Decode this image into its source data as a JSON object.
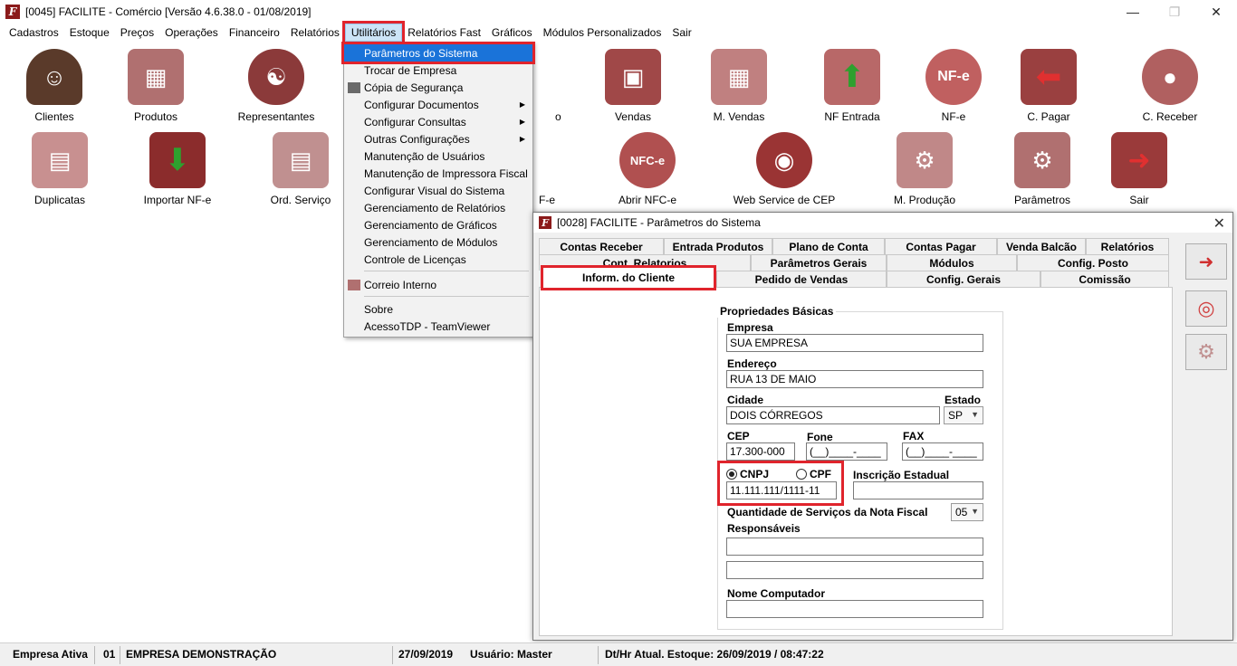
{
  "window": {
    "title": "[0045] FACILITE - Comércio [Versão 4.6.38.0 - 01/08/2019]",
    "min": "—",
    "max": "❐",
    "close": "✕"
  },
  "menu": [
    "Cadastros",
    "Estoque",
    "Preços",
    "Operações",
    "Financeiro",
    "Relatórios",
    "Utilitários",
    "Relatórios Fast",
    "Gráficos",
    "Módulos Personalizados",
    "Sair"
  ],
  "tiles": {
    "clientes": "Clientes",
    "produtos": "Produtos",
    "representantes": "Representantes",
    "o": "o",
    "vendas": "Vendas",
    "m_vendas": "M. Vendas",
    "nf_entrada": "NF Entrada",
    "nfe": "NF-e",
    "c_pagar": "C. Pagar",
    "c_receber": "C. Receber",
    "duplicatas": "Duplicatas",
    "importar_nfe": "Importar NF-e",
    "ord_servico": "Ord. Serviço",
    "f_e": "F-e",
    "abrir_nfce": "Abrir NFC-e",
    "web_service_cep": "Web Service de CEP",
    "m_producao": "M. Produção",
    "parametros": "Parâmetros",
    "sair": "Sair",
    "nfe_glyph": "NF-e",
    "nfce_glyph": "NFC-e"
  },
  "dropdown": {
    "items": [
      "Parâmetros do Sistema",
      "Trocar de Empresa",
      "Cópia de Segurança",
      "Configurar Documentos",
      "Configurar Consultas",
      "Outras Configurações",
      "Manutenção de Usuários",
      "Manutenção de Impressora Fiscal",
      "Configurar Visual do Sistema",
      "Gerenciamento de Relatórios",
      "Gerenciamento de Gráficos",
      "Gerenciamento de Módulos",
      "Controle de Licenças",
      "Correio Interno",
      "Sobre",
      "AcessoTDP - TeamViewer"
    ]
  },
  "dialog": {
    "title": "[0028] FACILITE - Parâmetros do Sistema",
    "close": "✕",
    "tabs_row1": [
      "Contas Receber",
      "Entrada Produtos",
      "Plano de Conta",
      "Contas Pagar",
      "Venda Balcão",
      "Relatórios"
    ],
    "tabs_row2": [
      "Cont. Relatorios",
      "Parâmetros Gerais",
      "Módulos",
      "Config. Posto"
    ],
    "tabs_row3": [
      "Inform. do Cliente",
      "Pedido de Vendas",
      "Config. Gerais",
      "Comissão"
    ],
    "group_title": "Propriedades Básicas",
    "labels": {
      "empresa": "Empresa",
      "endereco": "Endereço",
      "cidade": "Cidade",
      "estado": "Estado",
      "cep": "CEP",
      "fone": "Fone",
      "fax": "FAX",
      "cnpj": "CNPJ",
      "cpf": "CPF",
      "inscricao": "Inscrição Estadual",
      "qtd_servicos": "Quantidade de Serviços da Nota Fiscal",
      "responsaveis": "Responsáveis",
      "nome_computador": "Nome Computador"
    },
    "values": {
      "empresa": "SUA EMPRESA",
      "endereco": "RUA 13 DE MAIO",
      "cidade": "DOIS CÓRREGOS",
      "estado": "SP",
      "cep": "17.300-000",
      "fone": "(__)____-____",
      "fax": "(__)____-____",
      "cnpj": "11.111.111/1111-11",
      "inscricao": "",
      "qtd_servicos": "05",
      "responsavel1": "",
      "responsavel2": "",
      "nome_computador": ""
    }
  },
  "status": {
    "empresa_ativa": "Empresa Ativa",
    "codigo": "01",
    "empresa_nome": "EMPRESA DEMONSTRAÇÃO",
    "data": "27/09/2019",
    "usuario": "Usuário: Master",
    "estoque": "Dt/Hr Atual. Estoque: 26/09/2019 / 08:47:22"
  },
  "colors": {
    "accent_red": "#e0242c",
    "highlight_blue": "#1a73d9",
    "tile_maroon": "#8b2c2c"
  }
}
